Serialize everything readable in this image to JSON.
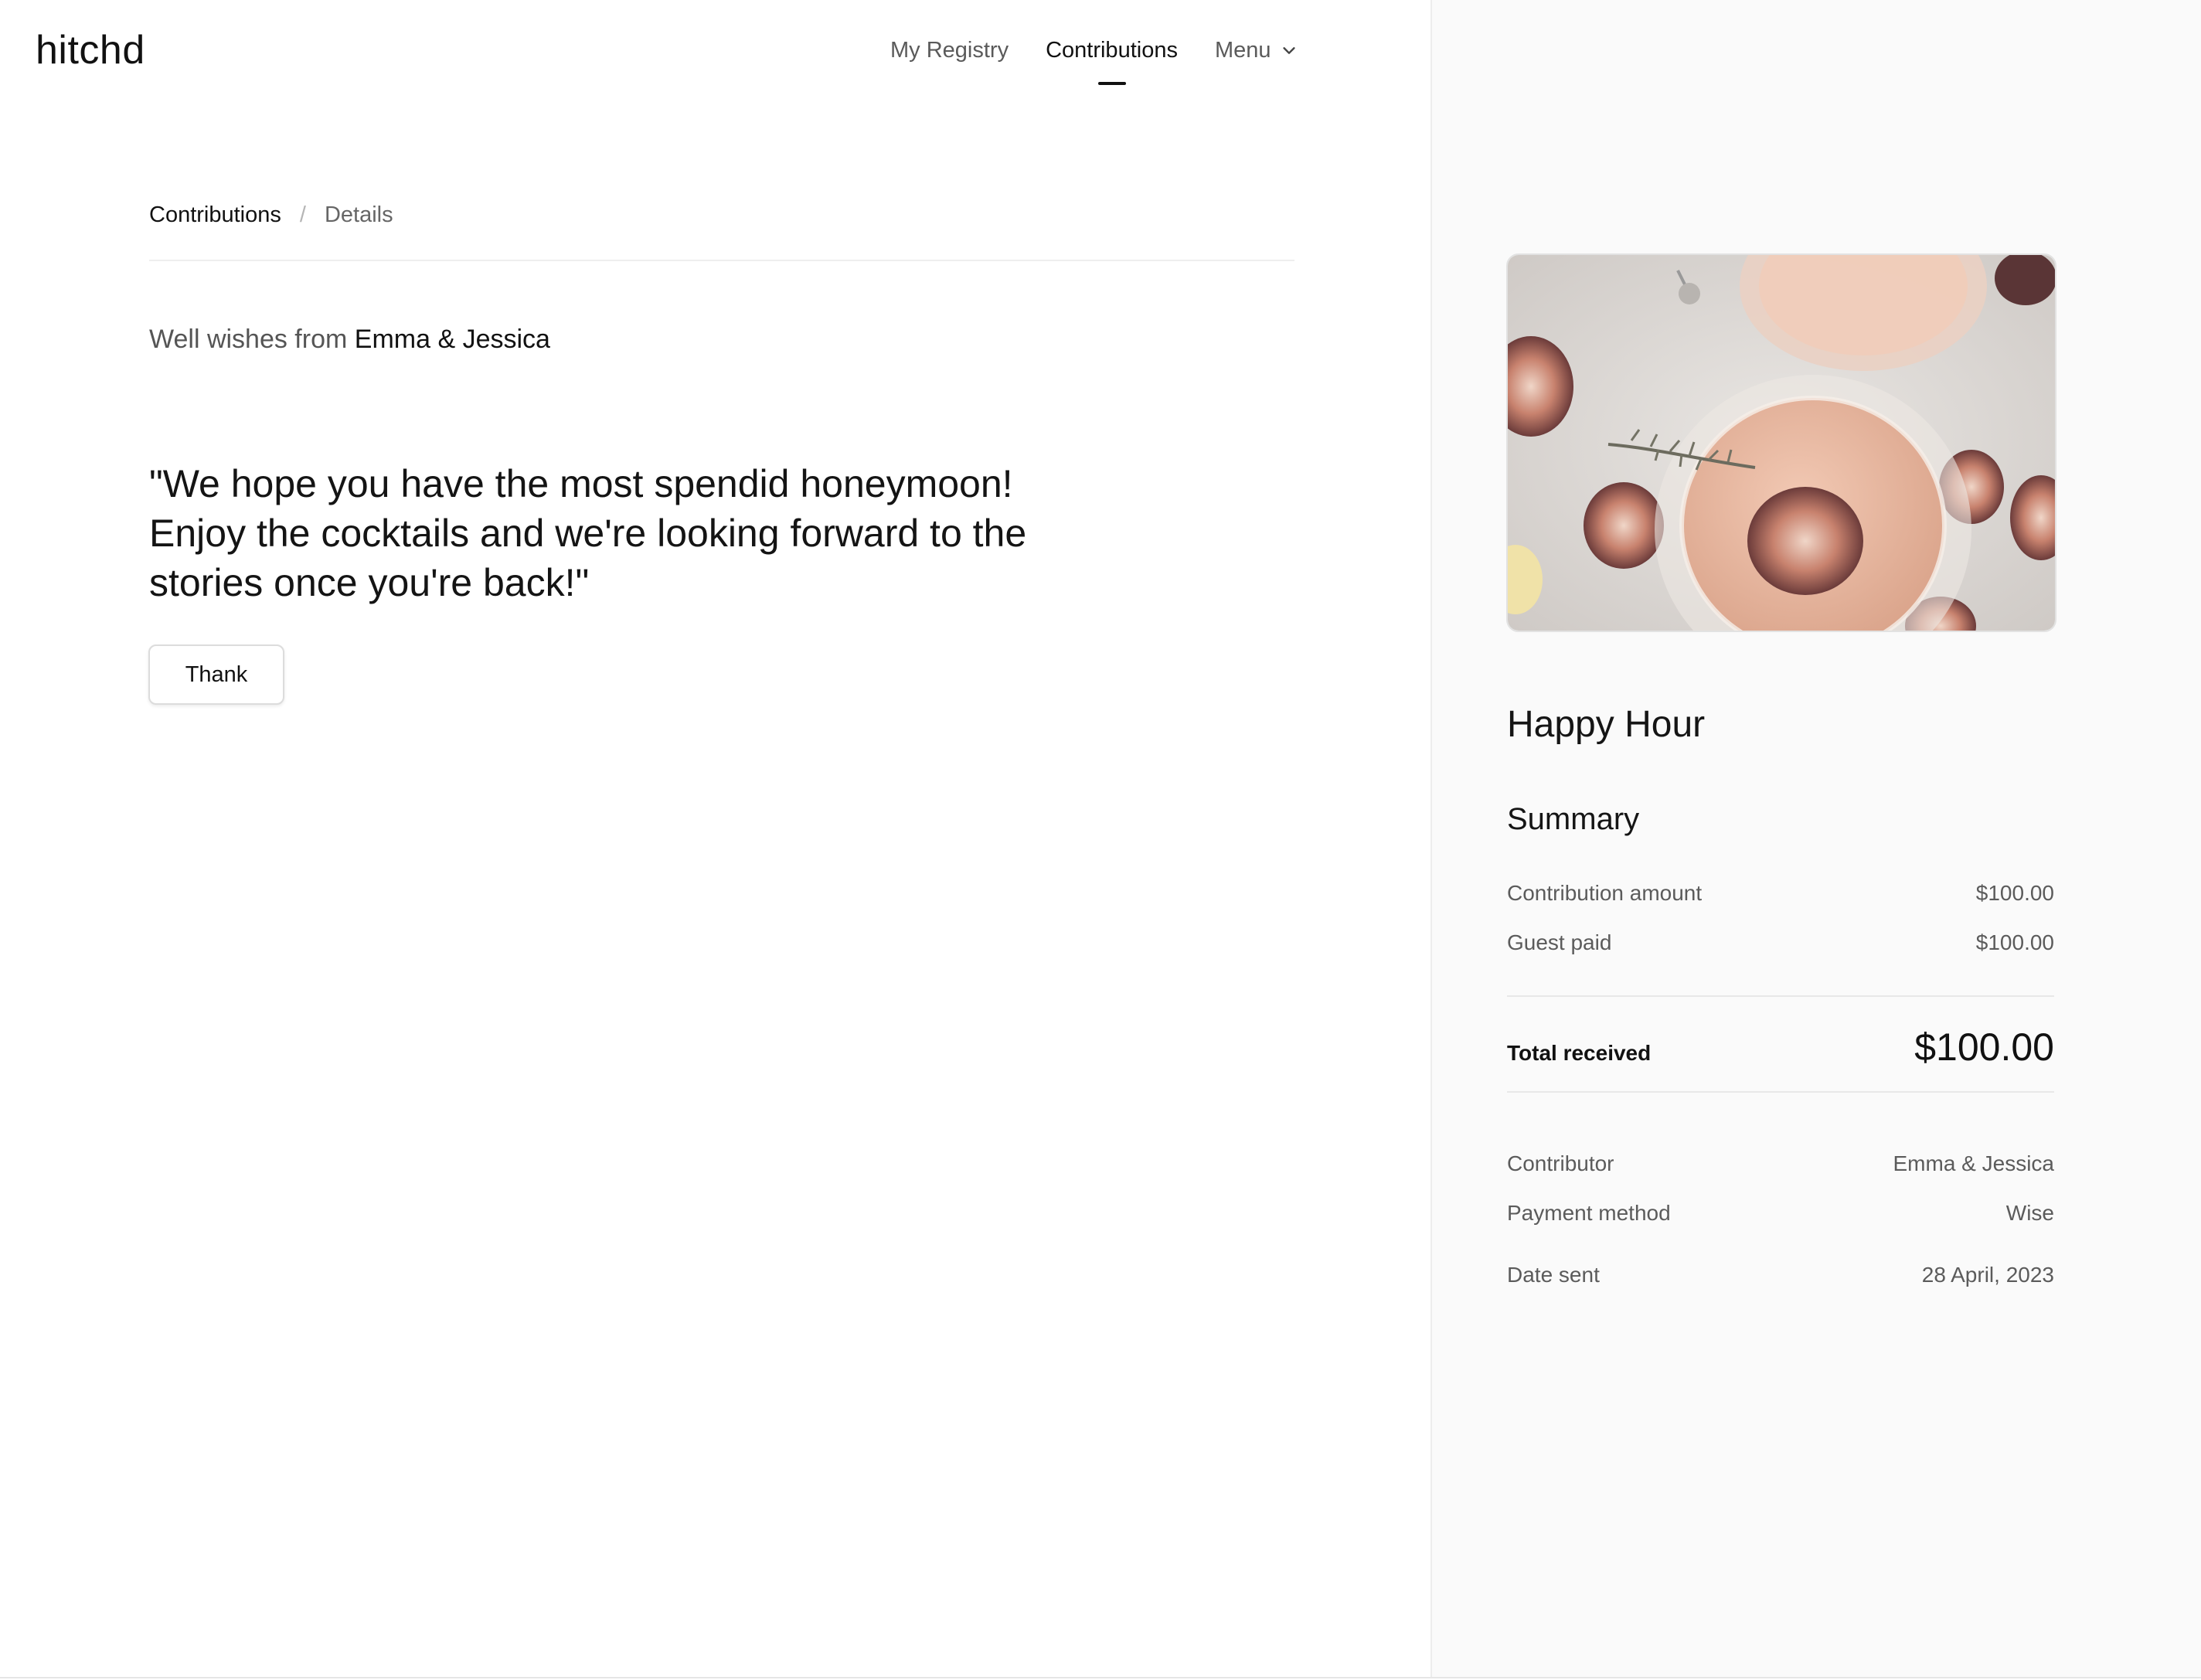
{
  "brand": {
    "logo_text": "hitchd"
  },
  "nav": {
    "items": [
      {
        "label": "My Registry"
      },
      {
        "label": "Contributions"
      },
      {
        "label": "Menu"
      }
    ]
  },
  "breadcrumb": {
    "parent": "Contributions",
    "separator": "/",
    "current": "Details"
  },
  "message": {
    "intro": "Well wishes from",
    "from": "Emma & Jessica",
    "quote": "\"We hope you have the most spendid honeymoon! Enjoy the cocktails and we're looking forward to the stories once you're back!\"",
    "thank_label": "Thank"
  },
  "gift": {
    "title": "Happy Hour",
    "summary_title": "Summary",
    "contribution_amount_label": "Contribution amount",
    "contribution_amount": "$100.00",
    "guest_paid_label": "Guest paid",
    "guest_paid": "$100.00",
    "total_label": "Total received",
    "total": "$100.00",
    "contributor_label": "Contributor",
    "contributor": "Emma & Jessica",
    "payment_method_label": "Payment method",
    "payment_method": "Wise",
    "date_sent_label": "Date sent",
    "date_sent": "28 April, 2023"
  },
  "icons": {
    "menu_chevron": "chevron-down-icon"
  },
  "colors": {
    "text": "#1c1c1c",
    "muted": "#5b5b5b",
    "panel_bg": "#fafafa",
    "divider": "#e8e8e8"
  }
}
